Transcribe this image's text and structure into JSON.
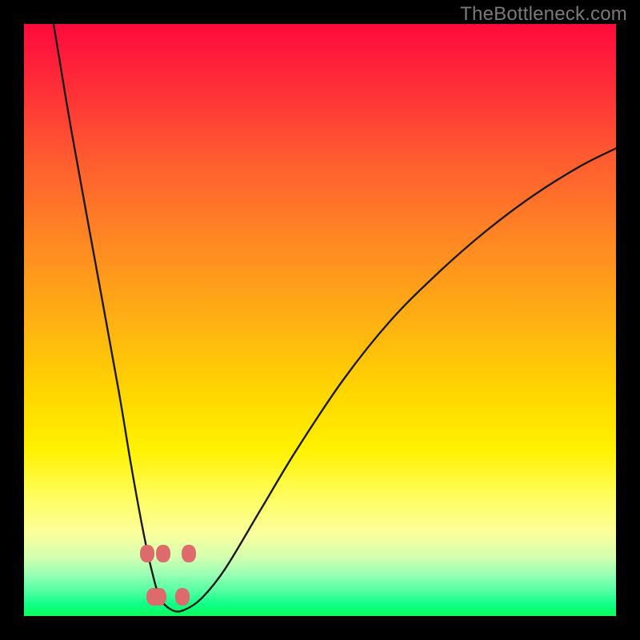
{
  "attribution": "TheBottleneck.com",
  "colors": {
    "frame_bg": "#000000",
    "attribution_text": "#7a7a7a",
    "curve_stroke": "#1a1a1a",
    "marker_fill": "#de6b6b",
    "gradient_top": "#ff0a3a",
    "gradient_bottom": "#0cff5a"
  },
  "chart_data": {
    "type": "line",
    "title": "",
    "xlabel": "",
    "ylabel": "",
    "x_range": [
      0,
      100
    ],
    "y_range": [
      0,
      100
    ],
    "grid": false,
    "legend": false,
    "series": [
      {
        "name": "curve",
        "x": [
          5,
          8,
          12,
          16,
          18,
          20,
          21.5,
          23,
          25,
          27,
          30,
          34,
          40,
          46,
          54,
          62,
          70,
          78,
          86,
          94,
          100
        ],
        "y": [
          100,
          82,
          60,
          38,
          26,
          15,
          8,
          3,
          1,
          1,
          3,
          8,
          18,
          28,
          40,
          50,
          58,
          65,
          71,
          76,
          79
        ]
      }
    ],
    "markers": {
      "name": "highlight-dots",
      "x": [
        20.8,
        23.5,
        21.9,
        22.9,
        26.7,
        27.9
      ],
      "y": [
        10.5,
        10.5,
        3.2,
        3.2,
        3.2,
        10.5
      ]
    },
    "background_gradient": {
      "orientation": "vertical",
      "stops": [
        {
          "pos": 0.0,
          "color": "#ff0a3a"
        },
        {
          "pos": 0.32,
          "color": "#ff7928"
        },
        {
          "pos": 0.62,
          "color": "#ffd500"
        },
        {
          "pos": 0.86,
          "color": "#fbff9c"
        },
        {
          "pos": 1.0,
          "color": "#0cff5a"
        }
      ]
    }
  }
}
